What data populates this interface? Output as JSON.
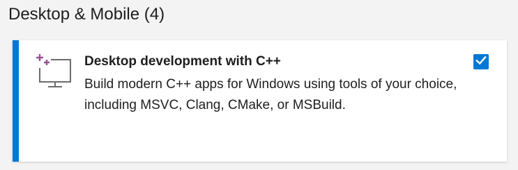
{
  "section": {
    "title": "Desktop & Mobile (4)"
  },
  "workload": {
    "title": "Desktop development with C++",
    "description": "Build modern C++ apps for Windows using tools of your choice, including MSVC, Clang, CMake, or MSBuild.",
    "icon": "desktop-monitor-icon",
    "checked": true
  },
  "colors": {
    "accent": "#0078d4",
    "icon_sparkle": "#9b4f96",
    "icon_monitor": "#6b6b6b",
    "checkmark": "#ffffff"
  }
}
